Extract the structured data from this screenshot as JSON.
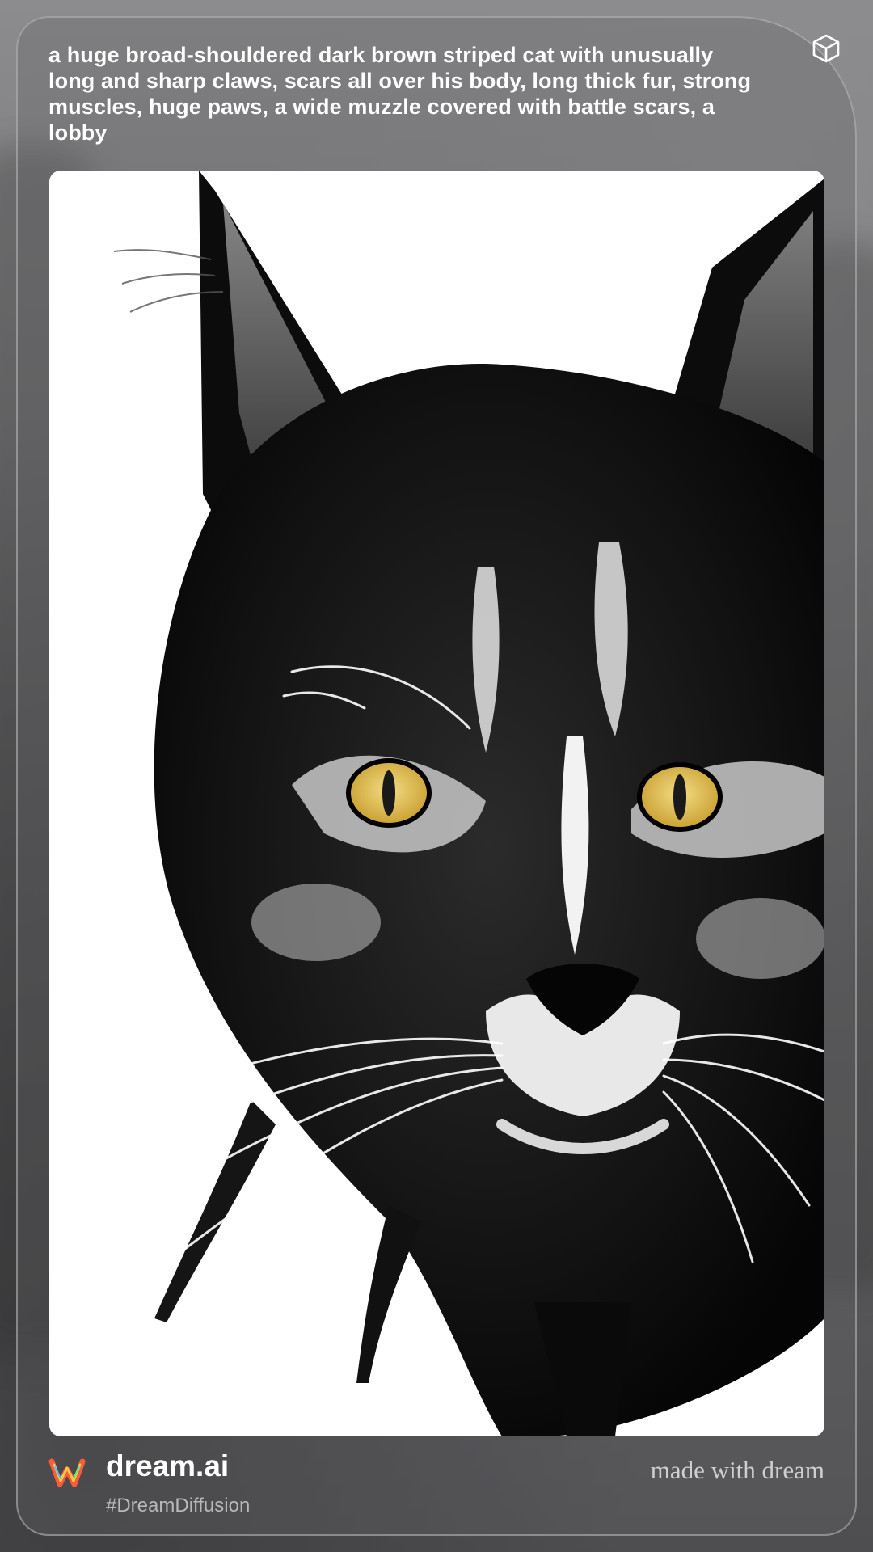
{
  "prompt": {
    "text": "a huge broad-shouldered dark brown striped cat with unusually long and sharp claws, scars all over his body, long thick fur, strong muscles, huge paws, a wide muzzle covered with battle scars, a lobby"
  },
  "header": {
    "icon": "cube-icon"
  },
  "artwork": {
    "subject": "cat-portrait",
    "eye_color": "#e7c65a"
  },
  "footer": {
    "logo_icon": "dream-logo-icon",
    "brand": "dream.ai",
    "hashtag": "#DreamDiffusion",
    "tagline": "made with dream"
  },
  "colors": {
    "text_primary": "#ffffff",
    "text_secondary": "#b8b8ba",
    "card_border": "#bebec0"
  }
}
